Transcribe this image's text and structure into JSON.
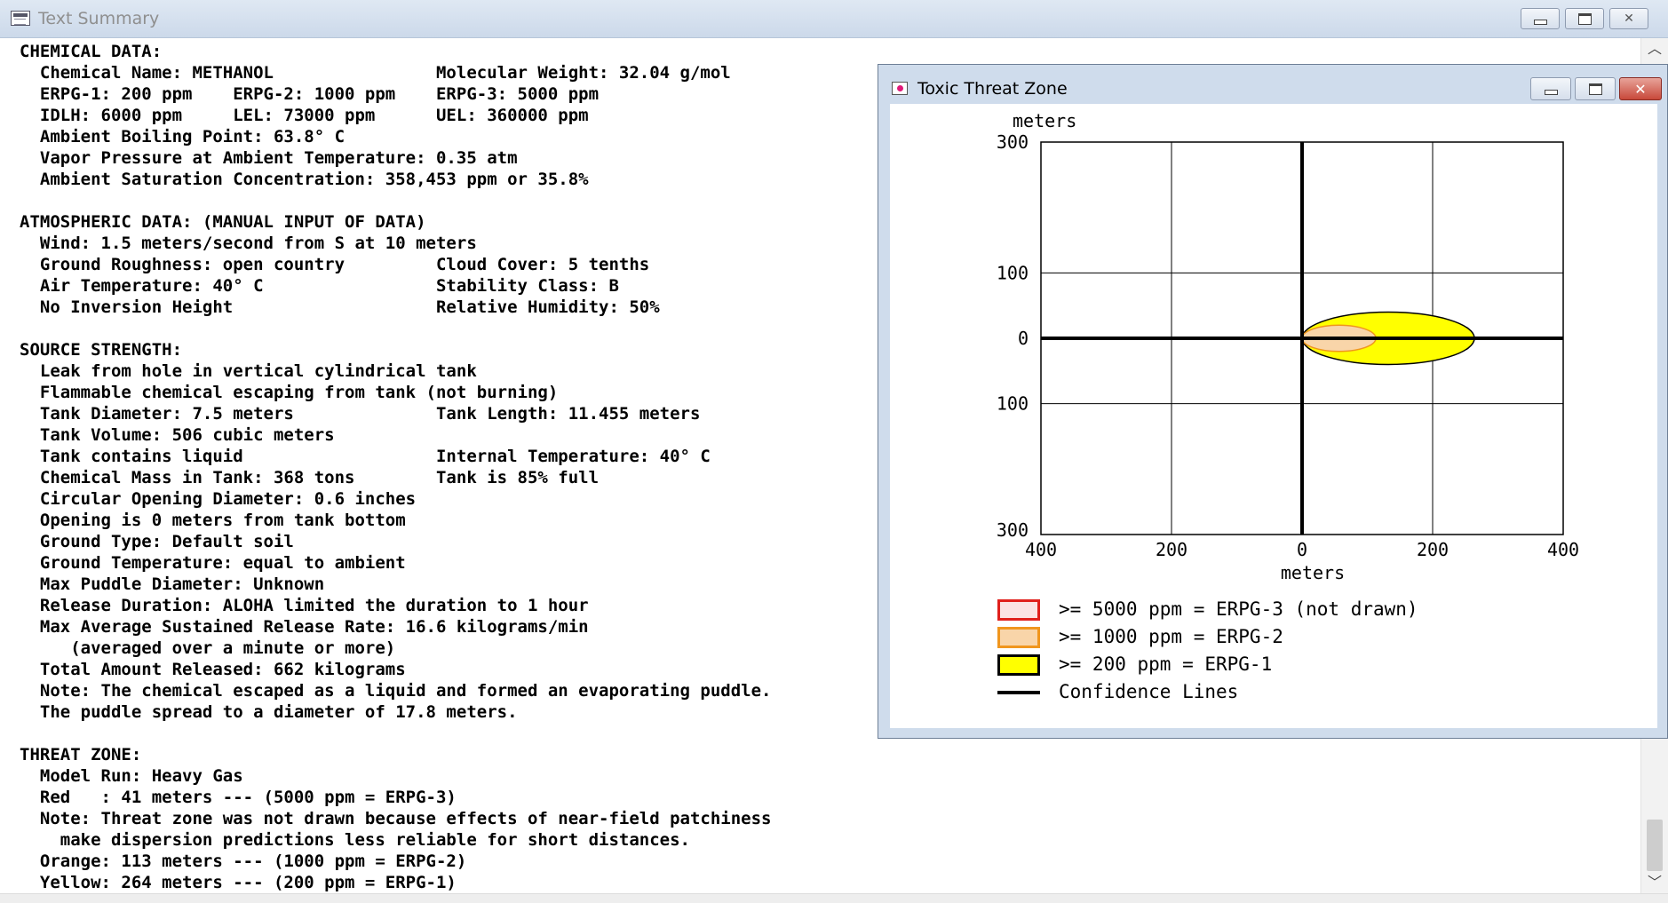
{
  "main_window": {
    "title": "Text Summary",
    "lines": [
      "CHEMICAL DATA:",
      "  Chemical Name: METHANOL                Molecular Weight: 32.04 g/mol",
      "  ERPG-1: 200 ppm    ERPG-2: 1000 ppm    ERPG-3: 5000 ppm",
      "  IDLH: 6000 ppm     LEL: 73000 ppm      UEL: 360000 ppm",
      "  Ambient Boiling Point: 63.8° C",
      "  Vapor Pressure at Ambient Temperature: 0.35 atm",
      "  Ambient Saturation Concentration: 358,453 ppm or 35.8%",
      "",
      "ATMOSPHERIC DATA: (MANUAL INPUT OF DATA)",
      "  Wind: 1.5 meters/second from S at 10 meters",
      "  Ground Roughness: open country         Cloud Cover: 5 tenths",
      "  Air Temperature: 40° C                 Stability Class: B",
      "  No Inversion Height                    Relative Humidity: 50%",
      "",
      "SOURCE STRENGTH:",
      "  Leak from hole in vertical cylindrical tank",
      "  Flammable chemical escaping from tank (not burning)",
      "  Tank Diameter: 7.5 meters              Tank Length: 11.455 meters",
      "  Tank Volume: 506 cubic meters",
      "  Tank contains liquid                   Internal Temperature: 40° C",
      "  Chemical Mass in Tank: 368 tons        Tank is 85% full",
      "  Circular Opening Diameter: 0.6 inches",
      "  Opening is 0 meters from tank bottom",
      "  Ground Type: Default soil",
      "  Ground Temperature: equal to ambient",
      "  Max Puddle Diameter: Unknown",
      "  Release Duration: ALOHA limited the duration to 1 hour",
      "  Max Average Sustained Release Rate: 16.6 kilograms/min",
      "     (averaged over a minute or more)",
      "  Total Amount Released: 662 kilograms",
      "  Note: The chemical escaped as a liquid and formed an evaporating puddle.",
      "  The puddle spread to a diameter of 17.8 meters.",
      "",
      "THREAT ZONE:",
      "  Model Run: Heavy Gas",
      "  Red   : 41 meters --- (5000 ppm = ERPG-3)",
      "  Note: Threat zone was not drawn because effects of near-field patchiness",
      "    make dispersion predictions less reliable for short distances.",
      "  Orange: 113 meters --- (1000 ppm = ERPG-2)",
      "  Yellow: 264 meters --- (200 ppm = ERPG-1)"
    ]
  },
  "threat_window": {
    "title": "Toxic Threat Zone",
    "legend": [
      {
        "label": ">= 5000 ppm = ERPG-3 (not drawn)",
        "fill": "#fbe3e3",
        "border": "#e0201c"
      },
      {
        "label": ">= 1000 ppm = ERPG-2",
        "fill": "#f9d5a9",
        "border": "#f0961e"
      },
      {
        "label": ">= 200 ppm = ERPG-1",
        "fill": "#ffff00",
        "border": "#000000"
      },
      {
        "label": "Confidence Lines",
        "fill": "",
        "border": "#000000"
      }
    ]
  },
  "chart_data": {
    "type": "area",
    "xlabel": "meters",
    "ylabel": "meters",
    "xlim": [
      -400,
      400
    ],
    "ylim": [
      -300,
      300
    ],
    "x_ticks": [
      {
        "value": -400,
        "label": "400"
      },
      {
        "value": -200,
        "label": "200"
      },
      {
        "value": 0,
        "label": "0"
      },
      {
        "value": 200,
        "label": "200"
      },
      {
        "value": 400,
        "label": "400"
      }
    ],
    "y_ticks": [
      {
        "value": 300,
        "label": "300"
      },
      {
        "value": 100,
        "label": "100"
      },
      {
        "value": 0,
        "label": "0"
      },
      {
        "value": -100,
        "label": "100"
      },
      {
        "value": -300,
        "label": "300"
      }
    ],
    "grid": true,
    "zones": [
      {
        "name": "ERPG-1",
        "x_min": 0,
        "x_max": 264,
        "half_width": 40,
        "fill": "#ffff00",
        "stroke": "#000000"
      },
      {
        "name": "ERPG-2",
        "x_min": 0,
        "x_max": 113,
        "half_width": 20,
        "fill": "#f9d5a9",
        "stroke": "#f0961e"
      }
    ],
    "confidence_lines": [
      {
        "x": [
          -400,
          400
        ],
        "y": [
          0,
          0
        ]
      },
      {
        "x": [
          0,
          0
        ],
        "y": [
          -300,
          300
        ]
      }
    ]
  }
}
